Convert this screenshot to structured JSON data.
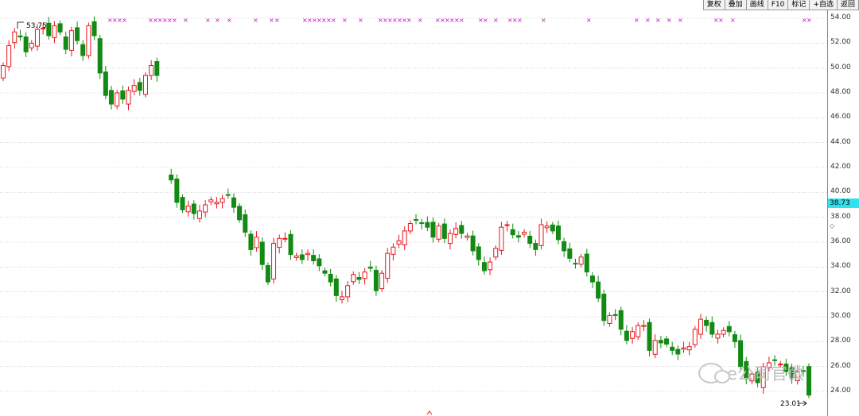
{
  "toolbar": {
    "items": [
      "复权",
      "叠加",
      "画线",
      "F10",
      "标记",
      "+自选",
      "返回"
    ]
  },
  "axis": {
    "current_price_label": "38.73",
    "scroll_marker": "◇"
  },
  "annotations": {
    "high_label": "53.75",
    "low_label": "23.01"
  },
  "watermark": {
    "text": "e公司官微"
  },
  "colors": {
    "up": "#e8171f",
    "down": "#138a13",
    "marker": "#d400d4",
    "grid": "#b8b8b8",
    "current_price_bg": "#2fe3ee"
  },
  "chart_data": {
    "type": "candlestick",
    "title": "",
    "ylim": [
      23,
      54
    ],
    "ytick_step": 2,
    "grid": true,
    "yticks": [
      "54.00",
      "52.00",
      "50.00",
      "48.00",
      "46.00",
      "44.00",
      "42.00",
      "40.00",
      "38.00",
      "36.00",
      "34.00",
      "32.00",
      "30.00",
      "28.00",
      "26.00",
      "24.00"
    ],
    "closes": [
      50.2,
      51.8,
      52.9,
      52.5,
      51.3,
      52.0,
      53.1,
      53.2,
      52.6,
      53.4,
      52.9,
      51.5,
      53.0,
      52.2,
      51.0,
      53.4,
      52.6,
      49.6,
      47.8,
      47.1,
      48.0,
      47.5,
      48.2,
      48.6,
      48.2,
      49.4,
      50.2,
      49.4,
      41.0,
      39.2,
      38.6,
      38.9,
      38.3,
      38.5,
      39.0,
      39.4,
      39.2,
      39.5,
      39.8,
      38.8,
      37.8,
      36.8,
      35.4,
      36.4,
      34.2,
      32.8,
      35.9,
      36.3,
      36.3,
      35.0,
      34.9,
      34.6,
      35.1,
      34.5,
      34.1,
      33.5,
      32.8,
      31.7,
      31.6,
      32.5,
      33.4,
      33.0,
      33.6,
      33.9,
      32.1,
      33.5,
      35.1,
      35.6,
      36.1,
      36.9,
      37.5,
      37.8,
      37.5,
      37.2,
      36.4,
      37.3,
      36.3,
      36.7,
      37.1,
      36.7,
      36.5,
      35.3,
      34.6,
      33.7,
      34.4,
      35.5,
      37.2,
      37.4,
      36.6,
      36.4,
      36.8,
      35.9,
      35.4,
      37.4,
      37.3,
      36.9,
      36.2,
      35.3,
      34.7,
      34.3,
      34.8,
      33.6,
      32.8,
      31.5,
      29.7,
      30.1,
      30.1,
      29.0,
      28.1,
      28.8,
      29.3,
      29.3,
      27.3,
      28.1,
      27.9,
      27.8,
      27.3,
      27.0,
      27.5,
      27.6,
      29.0,
      29.8,
      29.3,
      28.6,
      28.6,
      28.9,
      28.8,
      28.0,
      26.0,
      25.0,
      25.4,
      24.7,
      26.0,
      26.3,
      26.5,
      26.2,
      25.6,
      25.1,
      25.6,
      25.6,
      23.7
    ],
    "gap_after_index": 27,
    "high": 53.75,
    "low": 23.01,
    "current_price": 38.73
  }
}
